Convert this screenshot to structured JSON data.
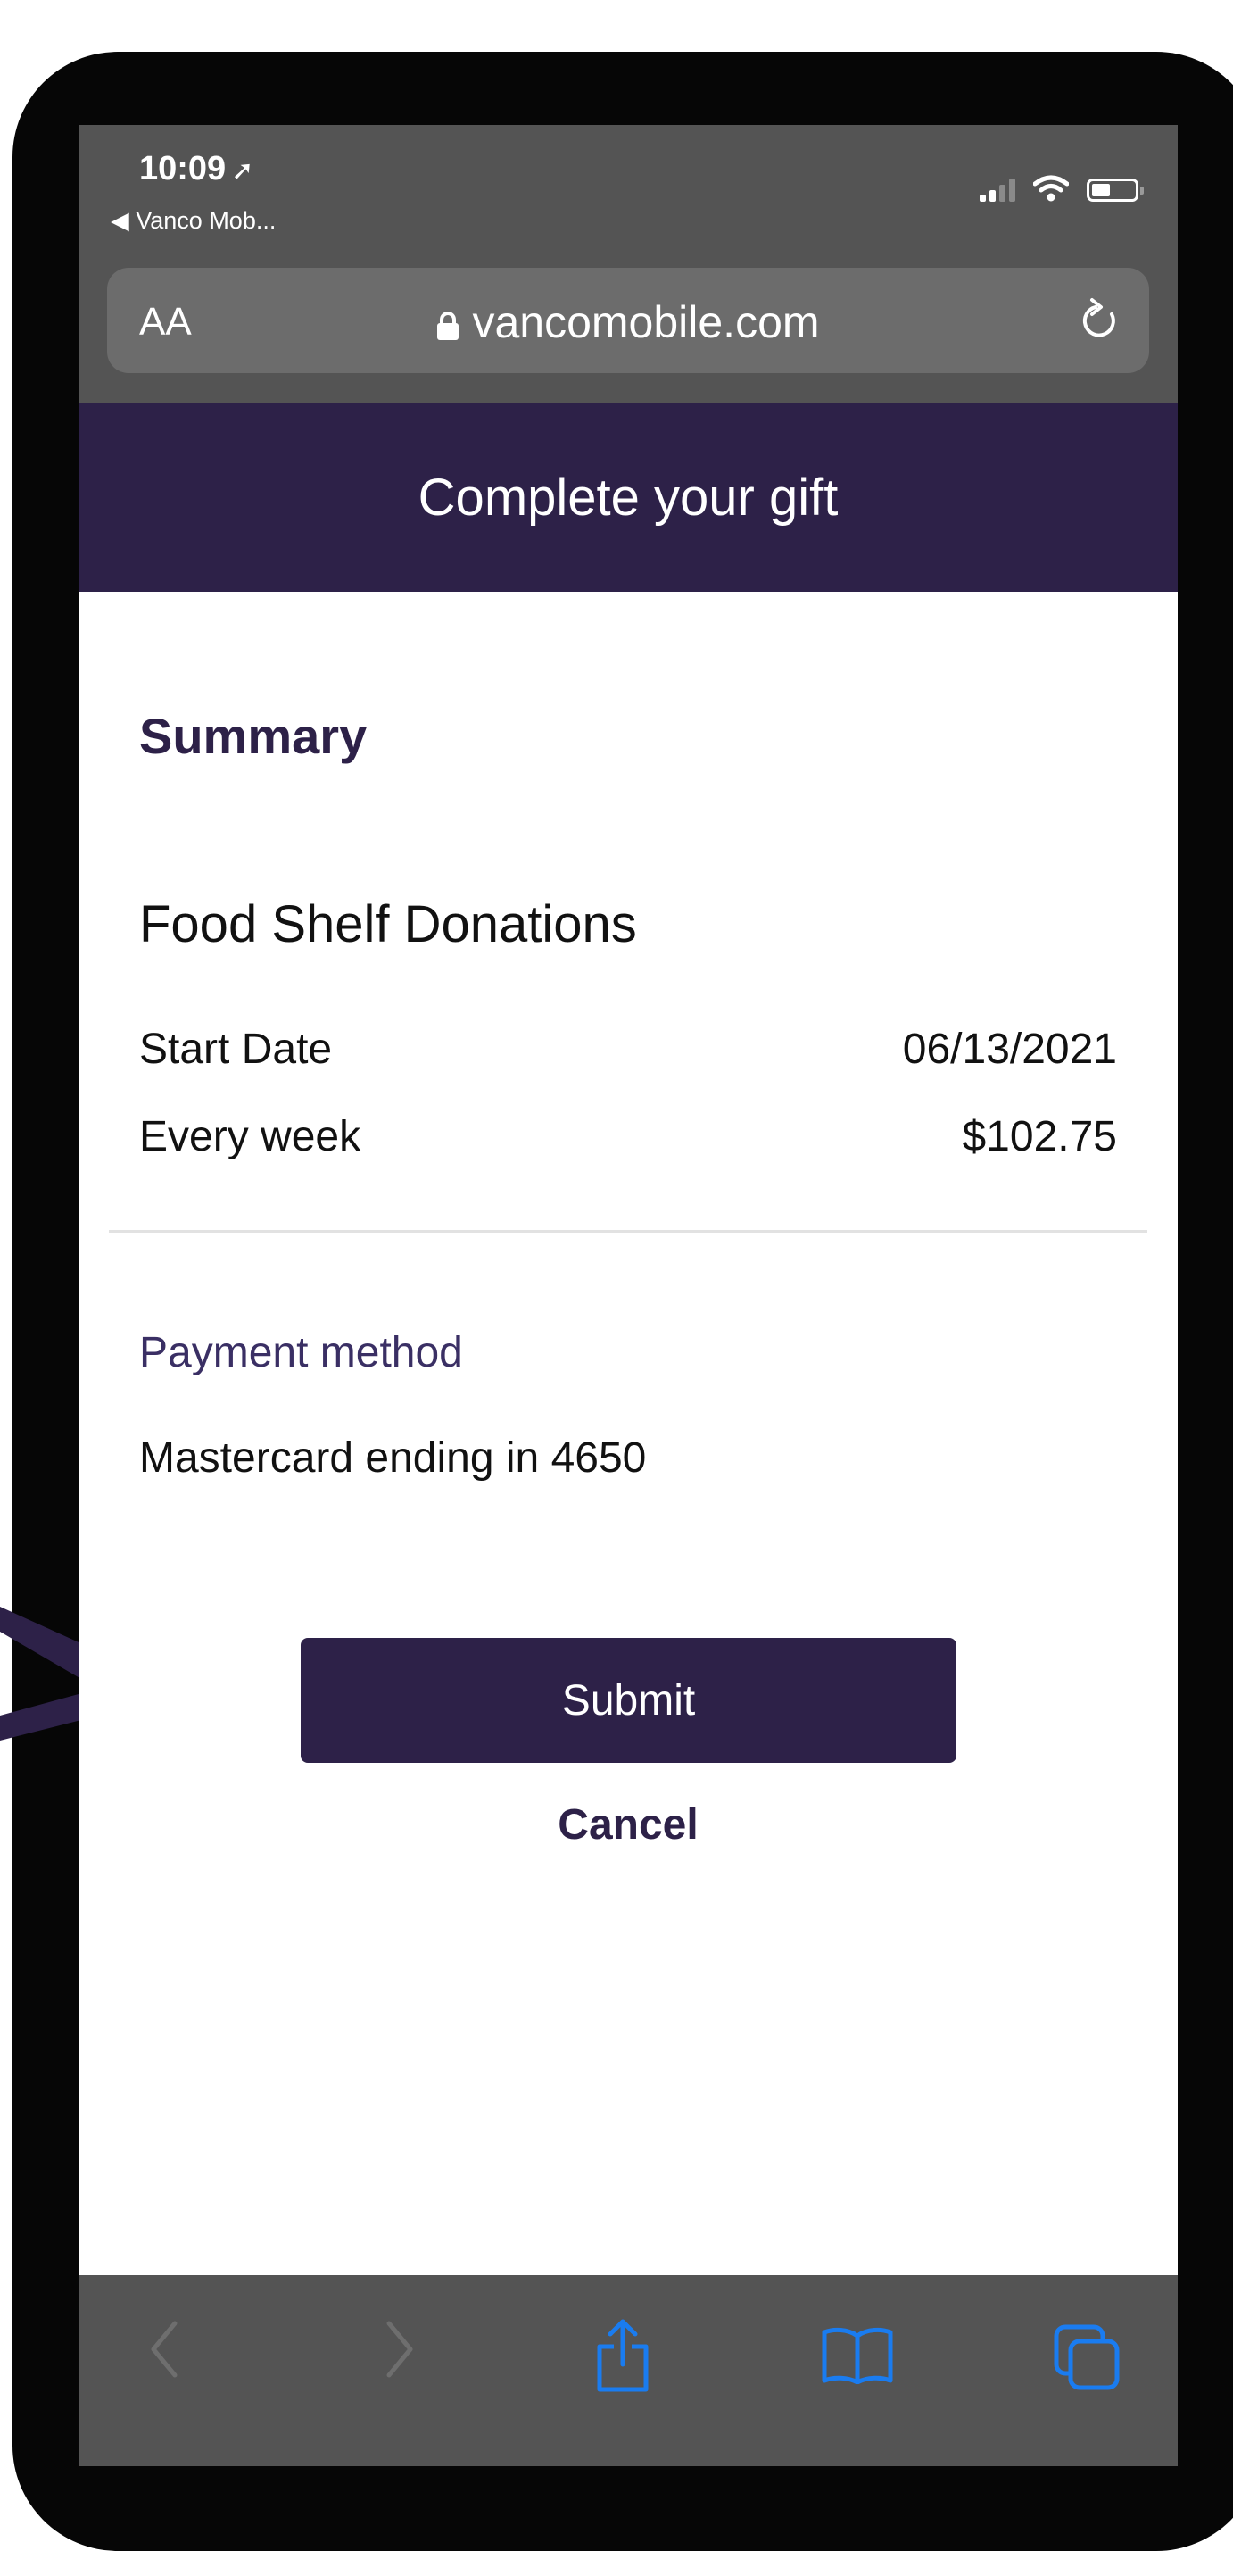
{
  "status_bar": {
    "time": "10:09",
    "back_app": "Vanco Mob..."
  },
  "browser": {
    "text_size_control": "AA",
    "url": "vancomobile.com"
  },
  "header": {
    "title": "Complete your gift"
  },
  "summary": {
    "heading": "Summary",
    "fund_name": "Food Shelf Donations",
    "start_date_label": "Start Date",
    "start_date_value": "06/13/2021",
    "frequency_label": "Every week",
    "amount_value": "$102.75"
  },
  "payment": {
    "label": "Payment method",
    "value": "Mastercard ending in 4650"
  },
  "actions": {
    "submit_label": "Submit",
    "cancel_label": "Cancel"
  },
  "colors": {
    "brand": "#2d2148",
    "safari_chrome": "#545454",
    "safari_active_icon": "#1a7cf0"
  },
  "icons": {
    "status": [
      "location-arrow-icon",
      "signal-icon",
      "wifi-icon",
      "battery-icon"
    ],
    "browser": [
      "lock-icon",
      "reload-icon"
    ],
    "toolbar": [
      "back-icon",
      "forward-icon",
      "share-icon",
      "bookmarks-icon",
      "tabs-icon"
    ]
  }
}
